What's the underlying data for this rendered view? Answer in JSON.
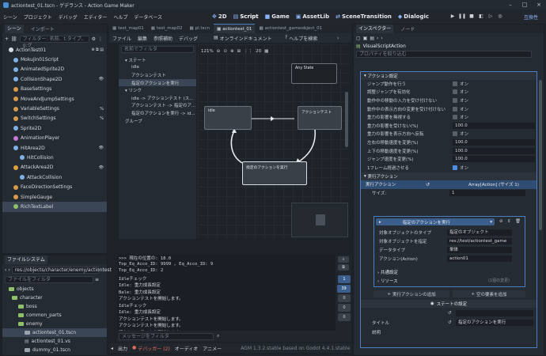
{
  "window": {
    "title": "actiontest_01.tscn - ゲデランス - Action Game Maker"
  },
  "menu": [
    "シーン",
    "プロジェクト",
    "デバッグ",
    "エディター",
    "ヘルプ",
    "データベース"
  ],
  "workspaces": [
    {
      "label": "2D",
      "icon": "2d-icon"
    },
    {
      "label": "Script",
      "icon": "script-icon"
    },
    {
      "label": "Game",
      "icon": "game-icon"
    },
    {
      "label": "AssetLib",
      "icon": "assetlib-icon"
    },
    {
      "label": "SceneTransition",
      "icon": "scenetransition-icon"
    },
    {
      "label": "Dialogic",
      "icon": "dialogic-icon"
    }
  ],
  "top_right": {
    "mode": "互換性"
  },
  "scene_panel": {
    "tabs": [
      "シーン",
      "インポート"
    ],
    "filter_placeholder": "フィルター: 名前、t:タイプ、g:グ",
    "nodes": [
      {
        "label": "ActionTest01",
        "color": "#d7dde5"
      },
      {
        "label": "Mokujin01Script",
        "color": "#7fb3e8"
      },
      {
        "label": "AnimatedSprite2D",
        "color": "#7fb3e8"
      },
      {
        "label": "CollisionShape2D",
        "color": "#7fb3e8"
      },
      {
        "label": "BaseSettings",
        "color": "#d89b4a"
      },
      {
        "label": "MoveAndJumpSettings",
        "color": "#d89b4a"
      },
      {
        "label": "VariableSettings",
        "color": "#d89b4a"
      },
      {
        "label": "SwitchSettings",
        "color": "#d89b4a"
      },
      {
        "label": "Sprite2D",
        "color": "#7fb3e8"
      },
      {
        "label": "AnimationPlayer",
        "color": "#c878d8"
      },
      {
        "label": "HitArea2D",
        "color": "#7fb3e8"
      },
      {
        "label": "HitCollision",
        "color": "#7fb3e8"
      },
      {
        "label": "AttackArea2D",
        "color": "#e0a040"
      },
      {
        "label": "AttackCollision",
        "color": "#7fb3e8"
      },
      {
        "label": "FaceDirectionSettings",
        "color": "#d89b4a"
      },
      {
        "label": "SimpleGauge",
        "color": "#d89b4a"
      },
      {
        "label": "RichTextLabel",
        "color": "#8fc06a"
      }
    ]
  },
  "filesystem": {
    "tab": "ファイルシステム",
    "path": "res://objects/character/enemy/actiontest",
    "filter_placeholder": "ファイルをフィルタ",
    "items": [
      "objects",
      "character",
      "boss",
      "common_parts",
      "enemy",
      "actiontest_01.tscn",
      "actiontest_01.vs",
      "dummy_01.tscn"
    ]
  },
  "editor_tabs": [
    "test_map01",
    "test_map02",
    "pl.tscn",
    "actiontest_01",
    "actiontest_gameobject_01"
  ],
  "vs_menu": {
    "file": "ファイル",
    "edit": "編集",
    "ref": "参照補助",
    "debug": "デバッグ",
    "online_doc": "オンラインドキュメント",
    "help_search": "ヘルプを検索"
  },
  "vs_list": {
    "filter_placeholder": "名前でフィルタ",
    "rows": [
      {
        "text": "▾ ステート",
        "indent": 8
      },
      {
        "text": "idle",
        "indent": 16
      },
      {
        "text": "アクションテスト",
        "indent": 16
      },
      {
        "text": "指定のアクションを実行",
        "indent": 16,
        "selected": true
      },
      {
        "text": "▾ リンク",
        "indent": 8
      },
      {
        "text": "idle -> アクションテスト (ス...",
        "indent": 16
      },
      {
        "text": "アクションテスト -> 指定のア...",
        "indent": 16
      },
      {
        "text": "指定のアクションを実行 -> id...",
        "indent": 16
      },
      {
        "text": "グループ",
        "indent": 8
      }
    ]
  },
  "graph": {
    "zoom": "121%",
    "snap": "20",
    "nodes": {
      "any_state": "Any State",
      "idle": "idle",
      "action_test": "アクションテスト",
      "run_action": "指定のアクションを実行"
    }
  },
  "console": {
    "lines": [
      "    >>> 現在の位置の: 18.0",
      "Top_Eq_Acco_ID: 9999 , Eq_Acco_ID: 9",
      "Top_Eq_Acco_ID: 2",
      "Idleチェック",
      "Idle: 重力成長設定",
      "Bale: 重力成長設定",
      "アクションテストを開始します。",
      "Idleチェック",
      "Idle: 重力成長設定",
      "アクションテストを開始します。",
      "アクションテストを開始します。",
      "アクションテストを開始します。",
      "アクションテストを開始します。"
    ],
    "filter_placeholder": "メッセージをフィルタ",
    "badges": [
      "1",
      "39",
      "0",
      "0",
      "0"
    ]
  },
  "bottom_tabs": [
    "出力",
    "デバッガー (2)",
    "オーディオ",
    "アニメー"
  ],
  "status": "AGM 1.3.2.stable based on Godot 4.4.1.stable",
  "inspector": {
    "tabs": [
      "インスペクター",
      "ノード"
    ],
    "class": "VisualScriptAction",
    "filter_placeholder": "プロパティを絞り込む",
    "section_title": "アクション設定",
    "props": [
      {
        "label": "ジャンプ動作を行う",
        "type": "check",
        "on": false,
        "value": "オン"
      },
      {
        "label": "調整ジャンプを有効化",
        "type": "check",
        "on": false,
        "value": "オン"
      },
      {
        "label": "動作中の移動の入力を受け付けない",
        "type": "check",
        "on": false,
        "value": "オン"
      },
      {
        "label": "動作中の表示方向の変更を受け付けない",
        "type": "check",
        "on": false,
        "value": "オン"
      },
      {
        "label": "重力の影響を無視する",
        "type": "check",
        "on": false,
        "value": "オン"
      },
      {
        "label": "重力の影響を受けない(%)",
        "type": "num",
        "value": "100.0"
      },
      {
        "label": "重力の影響を表示方向へ反転",
        "type": "check",
        "on": false,
        "value": "オン"
      },
      {
        "label": "左右の移動速度を変更(%)",
        "type": "num",
        "value": "100.0"
      },
      {
        "label": "上下の移動速度を変更(%)",
        "type": "num",
        "value": "100.0"
      },
      {
        "label": "ジャンプ速度を変更(%)",
        "type": "num",
        "value": "100.0"
      },
      {
        "label": "1フレーム経過させる",
        "type": "check",
        "on": true,
        "value": "オン"
      }
    ],
    "exec_section": "実行アクション",
    "exec_row": {
      "label": "実行アクション",
      "value": "Array[Action] (サイズ 1)"
    },
    "size": {
      "label": "サイズ:",
      "value": "1"
    },
    "resource_name": "指定のアクションを実行",
    "sub": [
      {
        "label": "対象オブジェクトのタイプ",
        "value": "指定のオブジェクト"
      },
      {
        "label": "対象オブジェクトを指定",
        "value": "res://test/actiontest_game"
      },
      {
        "label": "データタイプ",
        "value": "単体"
      },
      {
        "label": "アクション(Action)",
        "value": "action01"
      }
    ],
    "shared": "共通設定",
    "resource": "リソース",
    "resource_hint": "(1個の変更)",
    "add_action": "実行アクションの追加",
    "add_empty": "空の要素を追加",
    "state_settings": "ステートの設定",
    "title_label": "タイトル",
    "title_value": "指定のアクションを実行",
    "desc_label": "説明"
  }
}
